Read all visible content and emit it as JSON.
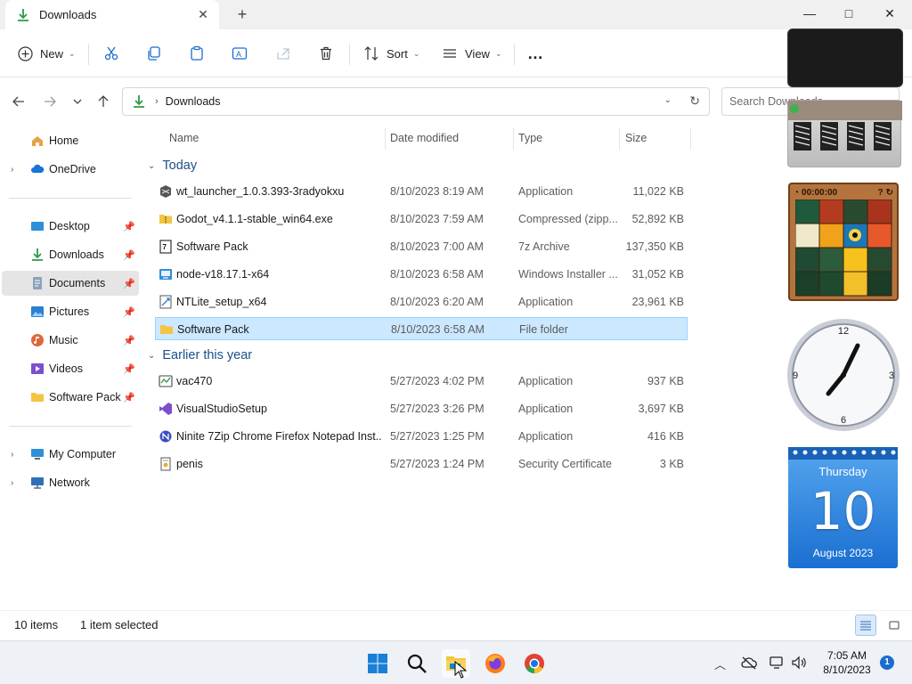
{
  "window": {
    "tab_title": "Downloads",
    "new_tab_label": "+",
    "minimize": "—",
    "maximize": "□",
    "close": "✕"
  },
  "toolbar": {
    "new_label": "New",
    "sort_label": "Sort",
    "view_label": "View",
    "more_label": "…"
  },
  "address": {
    "path": [
      "Downloads"
    ],
    "search_placeholder": "Search Downloads"
  },
  "sidebar": {
    "items": [
      {
        "label": "Home",
        "icon": "home-icon",
        "expandable": false,
        "pinned": false
      },
      {
        "label": "OneDrive",
        "icon": "cloud-icon",
        "expandable": true,
        "pinned": false
      },
      {
        "label": "Desktop",
        "icon": "desktop-icon",
        "expandable": false,
        "pinned": true
      },
      {
        "label": "Downloads",
        "icon": "download-icon",
        "expandable": false,
        "pinned": true
      },
      {
        "label": "Documents",
        "icon": "documents-icon",
        "expandable": false,
        "pinned": true,
        "selected": true
      },
      {
        "label": "Pictures",
        "icon": "pictures-icon",
        "expandable": false,
        "pinned": true
      },
      {
        "label": "Music",
        "icon": "music-icon",
        "expandable": false,
        "pinned": true
      },
      {
        "label": "Videos",
        "icon": "videos-icon",
        "expandable": false,
        "pinned": true
      },
      {
        "label": "Software Pack",
        "icon": "folder-icon",
        "expandable": false,
        "pinned": true
      },
      {
        "label": "My Computer",
        "icon": "computer-icon",
        "expandable": true,
        "pinned": false
      },
      {
        "label": "Network",
        "icon": "network-icon",
        "expandable": true,
        "pinned": false
      }
    ]
  },
  "columns": {
    "name": "Name",
    "date": "Date modified",
    "type": "Type",
    "size": "Size"
  },
  "groups": [
    {
      "label": "Today",
      "files": [
        {
          "name": "wt_launcher_1.0.3.393-3radyokxu",
          "date": "8/10/2023 8:19 AM",
          "type": "Application",
          "size": "11,022 KB",
          "icon": "app-icon"
        },
        {
          "name": "Godot_v4.1.1-stable_win64.exe",
          "date": "8/10/2023 7:59 AM",
          "type": "Compressed (zipp...",
          "size": "52,892 KB",
          "icon": "zip-folder-icon"
        },
        {
          "name": "Software Pack",
          "date": "8/10/2023 7:00 AM",
          "type": "7z Archive",
          "size": "137,350 KB",
          "icon": "archive-icon"
        },
        {
          "name": "node-v18.17.1-x64",
          "date": "8/10/2023 6:58 AM",
          "type": "Windows Installer ...",
          "size": "31,052 KB",
          "icon": "installer-icon"
        },
        {
          "name": "NTLite_setup_x64",
          "date": "8/10/2023 6:20 AM",
          "type": "Application",
          "size": "23,961 KB",
          "icon": "setup-icon"
        },
        {
          "name": "Software Pack",
          "date": "8/10/2023 6:58 AM",
          "type": "File folder",
          "size": "",
          "icon": "folder-icon",
          "selected": true
        }
      ]
    },
    {
      "label": "Earlier this year",
      "files": [
        {
          "name": "vac470",
          "date": "5/27/2023 4:02 PM",
          "type": "Application",
          "size": "937 KB",
          "icon": "app-icon"
        },
        {
          "name": "VisualStudioSetup",
          "date": "5/27/2023 3:26 PM",
          "type": "Application",
          "size": "3,697 KB",
          "icon": "visual-studio-icon"
        },
        {
          "name": "Ninite 7Zip Chrome Firefox Notepad Inst...",
          "date": "5/27/2023 1:25 PM",
          "type": "Application",
          "size": "416 KB",
          "icon": "ninite-icon"
        },
        {
          "name": "penis",
          "date": "5/27/2023 1:24 PM",
          "type": "Security Certificate",
          "size": "3 KB",
          "icon": "certificate-icon"
        }
      ]
    }
  ],
  "status": {
    "item_count": "10 items",
    "selection": "1 item selected"
  },
  "gadgets": {
    "clock": {
      "n12": "12",
      "n3": "3",
      "n6": "6",
      "n9": "9"
    },
    "calendar": {
      "weekday": "Thursday",
      "day": "10",
      "month_year": "August 2023"
    },
    "puzzle_timer": "00:00:00"
  },
  "taskbar": {
    "time": "7:05 AM",
    "date": "8/10/2023",
    "notification_count": "1"
  },
  "colors": {
    "accent": "#0067c0",
    "selection": "#cce8ff",
    "group_header": "#1b4f8a"
  }
}
